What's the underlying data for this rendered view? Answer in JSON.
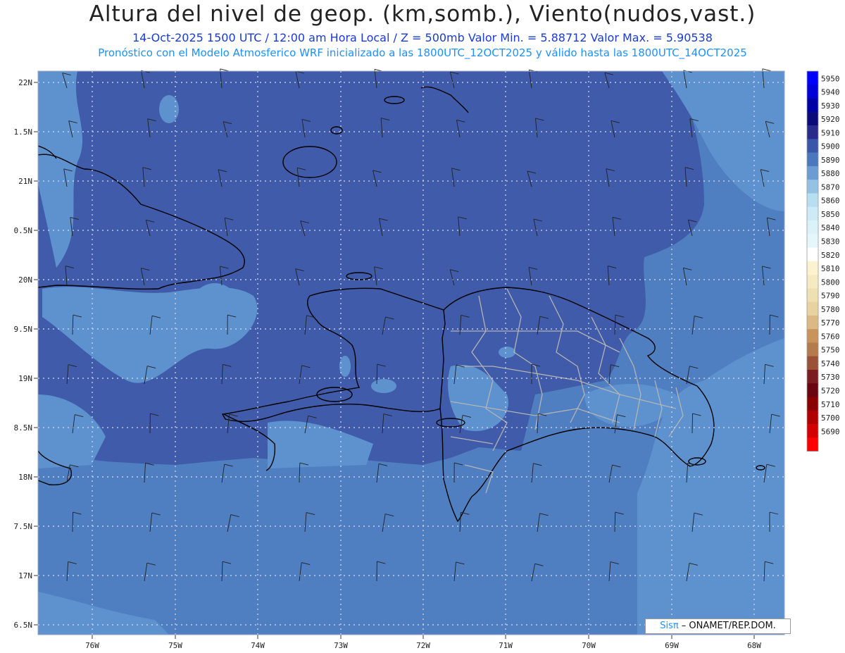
{
  "header": {
    "title": "Altura del nivel de geop. (km,somb.), Viento(nudos,vast.)",
    "line1": "14-Oct-2025  1500 UTC / 12:00 am Hora Local / Z = 500mb   Valor Min. = 5.88712  Valor Max. = 5.90538",
    "line2": "Pronóstico con el Modelo Atmosferico WRF inicializado a las 1800UTC_12OCT2025 y válido hasta las  1800UTC_14OCT2025"
  },
  "map": {
    "lon_labels": [
      "76W",
      "75W",
      "74W",
      "73W",
      "72W",
      "71W",
      "70W",
      "69W",
      "68W"
    ],
    "lat_labels": [
      "22N",
      "1.5N",
      "21N",
      "0.5N",
      "20N",
      "9.5N",
      "19N",
      "8.5N",
      "18N",
      "7.5N",
      "17N",
      "6.5N"
    ],
    "colors": {
      "deep": "#3f5ba9",
      "mid": "#4f7fc0",
      "light": "#5d92cf",
      "coast": "#000000",
      "provinces": "#b4b4b4",
      "grid": "#d6dcef"
    }
  },
  "legend": {
    "levels": [
      "5950",
      "5940",
      "5930",
      "5920",
      "5910",
      "5900",
      "5890",
      "5880",
      "5870",
      "5860",
      "5850",
      "5840",
      "5830",
      "5820",
      "5810",
      "5800",
      "5790",
      "5780",
      "5770",
      "5760",
      "5750",
      "5740",
      "5730",
      "5720",
      "5710",
      "5700",
      "5690"
    ],
    "colors": [
      "#0000ff",
      "#0000d8",
      "#0000a8",
      "#0a0a78",
      "#2a2a8c",
      "#3a56a8",
      "#4a78bc",
      "#6c9dd2",
      "#93c2e3",
      "#b7dff0",
      "#cdebf6",
      "#dcf2f9",
      "#e6f7fb",
      "#ffffff",
      "#fbf3cf",
      "#f5ebc3",
      "#efe0b3",
      "#e8d3a0",
      "#dcb884",
      "#c9935e",
      "#b57b4c",
      "#9a5138",
      "#7a1e22",
      "#6a0612",
      "#8a0000",
      "#b00000",
      "#d40000",
      "#ff0000"
    ]
  },
  "credit": {
    "brand": "Sis",
    "pi": "π",
    "rest": " – ONAMET/REP.DOM."
  }
}
